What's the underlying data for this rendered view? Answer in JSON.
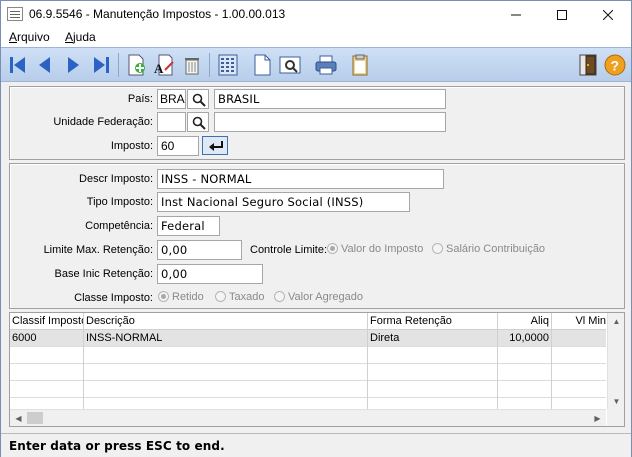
{
  "window": {
    "title": "06.9.5546 - Manutenção Impostos - 1.00.00.013",
    "minimize_icon": "minimize-icon",
    "maximize_icon": "maximize-icon",
    "close_icon": "close-icon"
  },
  "menu": {
    "items": [
      {
        "label": "Arquivo",
        "hotkey": "A"
      },
      {
        "label": "Ajuda",
        "hotkey": "A"
      }
    ]
  },
  "toolbar": {
    "icons": [
      "first-record-icon",
      "previous-record-icon",
      "next-record-icon",
      "last-record-icon",
      "add-record-icon",
      "edit-text-icon",
      "delete-trash-icon",
      "calendar-icon",
      "new-document-icon",
      "preview-icon",
      "print-icon",
      "clipboard-icon",
      "exit-door-icon",
      "help-icon"
    ]
  },
  "header_form": {
    "pais_label": "País:",
    "pais_code": "BRA",
    "pais_name": "BRASIL",
    "uf_label": "Unidade Federação:",
    "uf_code": "",
    "uf_name": "",
    "imposto_label": "Imposto:",
    "imposto_value": "60"
  },
  "detail_form": {
    "descr_label": "Descr  Imposto:",
    "descr_value": "INSS - NORMAL",
    "tipo_label": "Tipo Imposto:",
    "tipo_value": "Inst Nacional Seguro Social (INSS)",
    "competencia_label": "Competência:",
    "competencia_value": "Federal",
    "limite_label": "Limite Max. Retenção:",
    "limite_value": "0,00",
    "controle_label": "Controle Limite:",
    "controle_options": [
      "Valor do Imposto",
      "Salário Contribuição"
    ],
    "controle_selected": 0,
    "base_label": "Base Inic Retenção:",
    "base_value": "0,00",
    "classe_label": "Classe Imposto:",
    "classe_options": [
      "Retido",
      "Taxado",
      "Valor Agregado"
    ],
    "classe_selected": 0
  },
  "grid": {
    "columns": [
      "Classif Imposto",
      "Descrição",
      "Forma Retenção",
      "Aliq",
      "Vl Min"
    ],
    "rows": [
      [
        "6000",
        "INSS-NORMAL",
        "Direta",
        "10,0000",
        ""
      ]
    ]
  },
  "status": {
    "text": "Enter data or press ESC to end."
  },
  "colors": {
    "toolbar_bg": "#c3d6ef",
    "selected_row": "#e3e3e3"
  }
}
